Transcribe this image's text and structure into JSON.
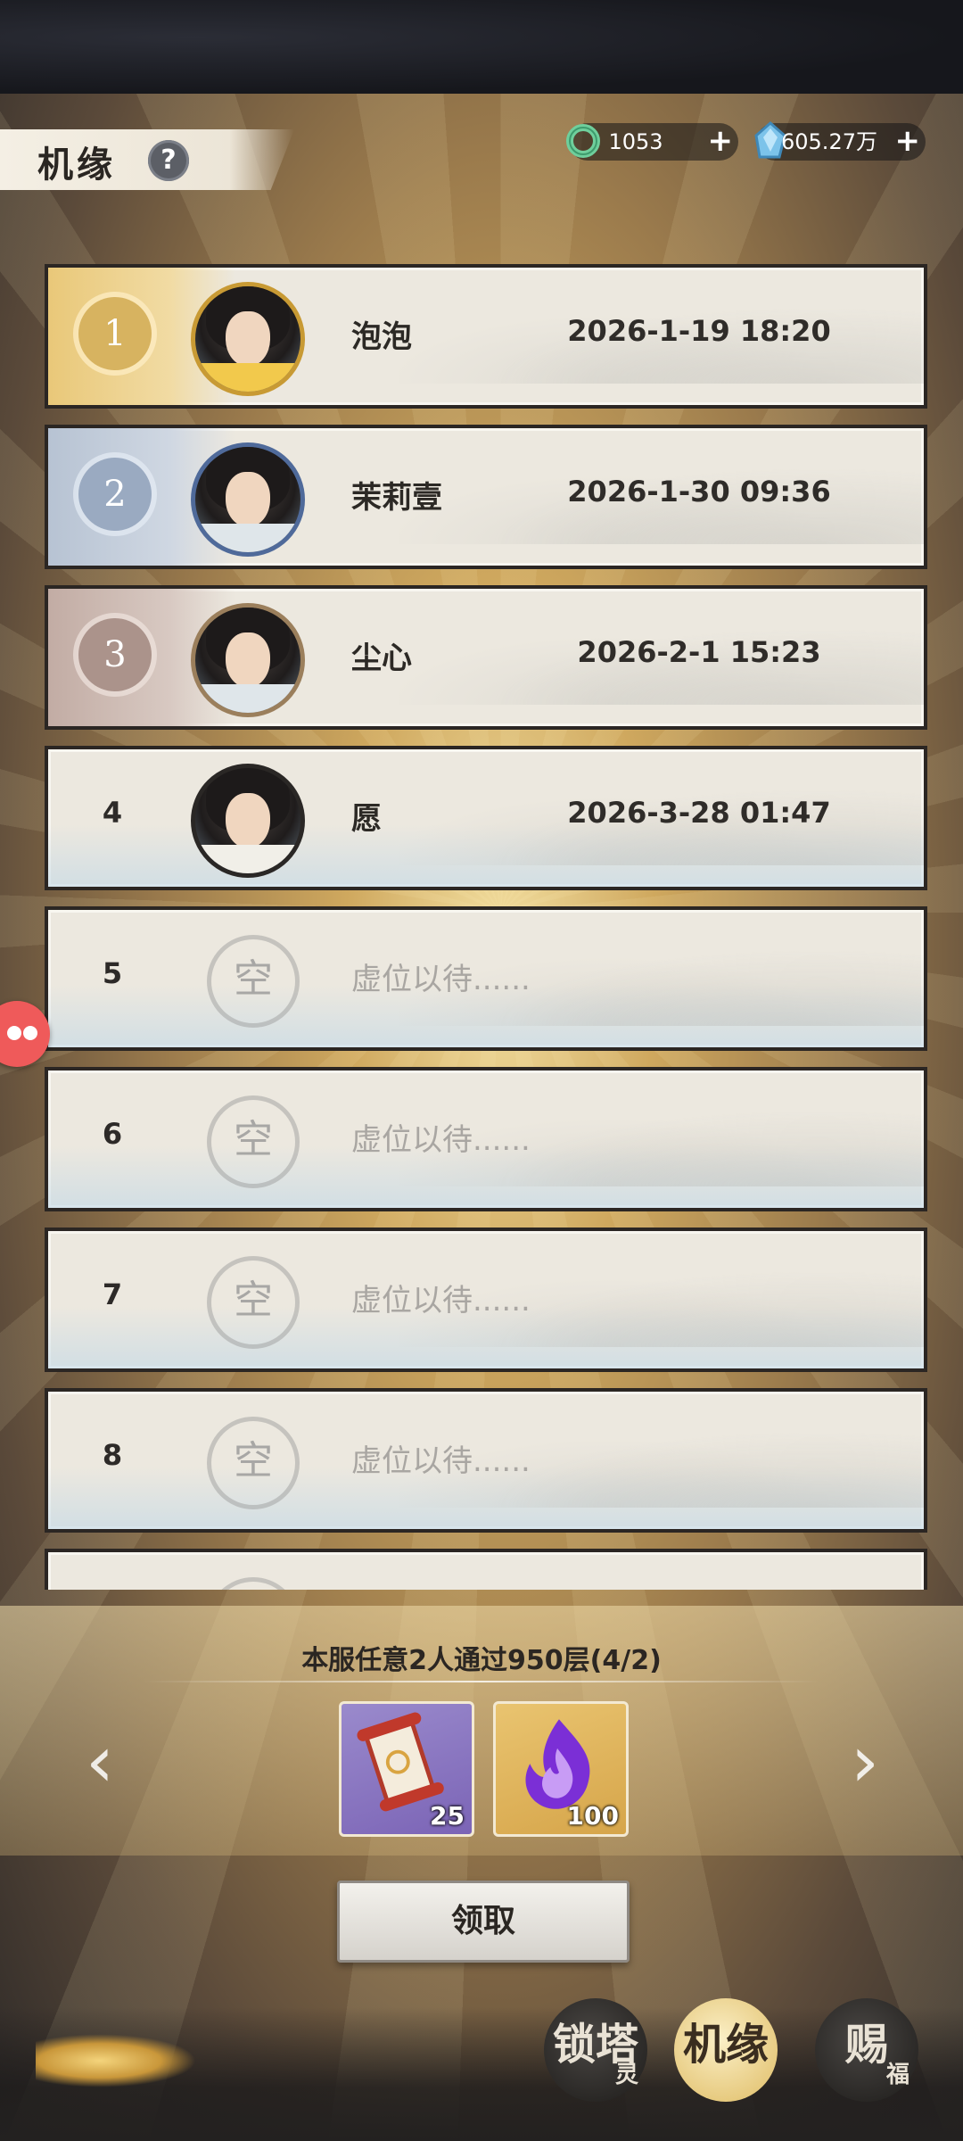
{
  "header": {
    "title": "机缘",
    "help_label": "?",
    "currency_jade": "1053",
    "currency_spirit_stone": "605.27万",
    "plus_label": "+"
  },
  "ranking": [
    {
      "rank": "1",
      "name": "泡泡",
      "time": "2026-1-19 18:20",
      "filled": true
    },
    {
      "rank": "2",
      "name": "茉莉壹",
      "time": "2026-1-30 09:36",
      "filled": true
    },
    {
      "rank": "3",
      "name": "尘心",
      "time": "2026-2-1 15:23",
      "filled": true
    },
    {
      "rank": "4",
      "name": "愿",
      "time": "2026-3-28 01:47",
      "filled": true
    },
    {
      "rank": "5",
      "name": "虚位以待......",
      "time": "",
      "filled": false
    },
    {
      "rank": "6",
      "name": "虚位以待......",
      "time": "",
      "filled": false
    },
    {
      "rank": "7",
      "name": "虚位以待......",
      "time": "",
      "filled": false
    },
    {
      "rank": "8",
      "name": "虚位以待......",
      "time": "",
      "filled": false
    }
  ],
  "empty_slot_glyph": "空",
  "task": {
    "description": "本服任意2人通过950层(4/2)",
    "rewards": [
      {
        "icon": "talisman-scroll-icon",
        "quantity": "25"
      },
      {
        "icon": "purple-flame-icon",
        "quantity": "100"
      }
    ],
    "claim_label": "领取"
  },
  "bottom_tabs": [
    {
      "main": "锁塔",
      "sub": "灵"
    },
    {
      "main": "机缘",
      "sub": ""
    },
    {
      "main": "赐",
      "sub": "福"
    }
  ],
  "colors": {
    "rank1": "#d9b25a",
    "rank2": "#8fa4c2",
    "rank3": "#a88e86",
    "card_border": "#2b2623"
  }
}
